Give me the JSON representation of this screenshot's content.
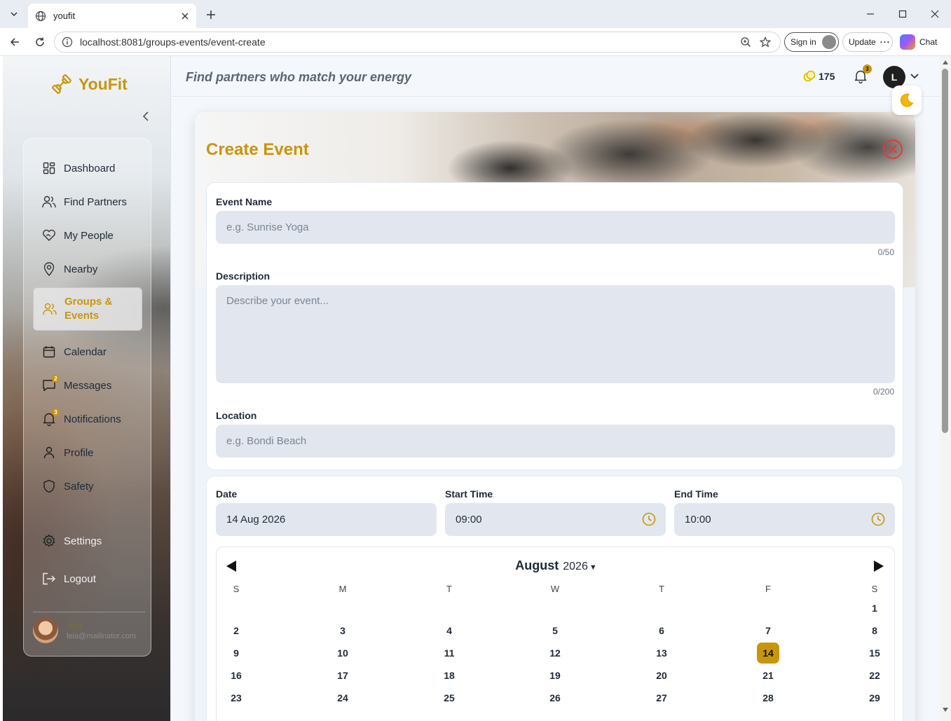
{
  "browser": {
    "tab_title": "youfit",
    "url": "localhost:8081/groups-events/event-create",
    "sign_in_label": "Sign in",
    "update_label": "Update",
    "chat_label": "Chat"
  },
  "app": {
    "brand": "YouFit",
    "tagline": "Find partners who match your energy",
    "points": "175",
    "notification_count": "3",
    "user_initial": "L",
    "accent_color": "#c8960c"
  },
  "sidebar": {
    "items": [
      {
        "label": "Dashboard",
        "icon": "dashboard-icon"
      },
      {
        "label": "Find Partners",
        "icon": "users-icon"
      },
      {
        "label": "My People",
        "icon": "heart-hand-icon"
      },
      {
        "label": "Nearby",
        "icon": "map-pin-icon"
      },
      {
        "label": "Groups & Events",
        "icon": "group-icon",
        "active": true
      },
      {
        "label": "Calendar",
        "icon": "calendar-icon"
      },
      {
        "label": "Messages",
        "icon": "message-icon",
        "badge": "2"
      },
      {
        "label": "Notifications",
        "icon": "bell-icon",
        "badge": "3"
      },
      {
        "label": "Profile",
        "icon": "user-icon"
      },
      {
        "label": "Safety",
        "icon": "shield-icon"
      },
      {
        "label": "Settings",
        "icon": "gear-icon"
      },
      {
        "label": "Logout",
        "icon": "logout-icon"
      }
    ],
    "user": {
      "name": "leia",
      "email": "leia@mailinator.com"
    }
  },
  "form": {
    "title": "Create Event",
    "event_name": {
      "label": "Event Name",
      "placeholder": "e.g. Sunrise Yoga",
      "value": "",
      "counter": "0/50"
    },
    "description": {
      "label": "Description",
      "placeholder": "Describe your event...",
      "value": "",
      "counter": "0/200"
    },
    "location": {
      "label": "Location",
      "placeholder": "e.g. Bondi Beach",
      "value": ""
    },
    "date": {
      "label": "Date",
      "value": "14 Aug 2026"
    },
    "start_time": {
      "label": "Start Time",
      "value": "09:00"
    },
    "end_time": {
      "label": "End Time",
      "value": "10:00"
    }
  },
  "calendar": {
    "month": "August",
    "year": "2026",
    "weekdays": [
      "S",
      "M",
      "T",
      "W",
      "T",
      "F",
      "S"
    ],
    "weeks": [
      [
        "",
        "",
        "",
        "",
        "",
        "",
        "1"
      ],
      [
        "2",
        "3",
        "4",
        "5",
        "6",
        "7",
        "8"
      ],
      [
        "9",
        "10",
        "11",
        "12",
        "13",
        "14",
        "15"
      ],
      [
        "16",
        "17",
        "18",
        "19",
        "20",
        "21",
        "22"
      ],
      [
        "23",
        "24",
        "25",
        "26",
        "27",
        "28",
        "29"
      ]
    ],
    "selected_day": "14"
  }
}
